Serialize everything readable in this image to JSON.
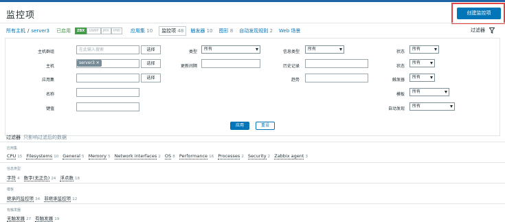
{
  "header": {
    "title": "监控项",
    "create_button": "创建监控项"
  },
  "breadcrumbs": {
    "all_hosts": "所有主机",
    "separator": "/",
    "host": "server3",
    "status": "已启用",
    "interfaces": [
      "ZBX",
      "SNMP",
      "JMX",
      "IPMI"
    ],
    "tabs": [
      {
        "label": "应用集",
        "count": "10"
      },
      {
        "label": "监控项",
        "count": "48"
      },
      {
        "label": "触发器",
        "count": "10"
      },
      {
        "label": "图形",
        "count": "8"
      },
      {
        "label": "自动发现规则",
        "count": "2"
      },
      {
        "label": "Web 场景",
        "count": ""
      }
    ]
  },
  "filter_toggle": {
    "label": "过滤器"
  },
  "filter": {
    "host_group": {
      "label": "主机群组",
      "placeholder": "在此输入搜索",
      "button": "选择"
    },
    "host": {
      "label": "主机",
      "tag": "server3",
      "button": "选择"
    },
    "application": {
      "label": "应用集",
      "button": "选择"
    },
    "name": {
      "label": "名称"
    },
    "key": {
      "label": "键值"
    },
    "type": {
      "label": "类型",
      "value": "所有"
    },
    "update_interval": {
      "label": "更新间隔"
    },
    "info_type": {
      "label": "信息类型",
      "value": "所有"
    },
    "history": {
      "label": "历史记录"
    },
    "trends": {
      "label": "趋势"
    },
    "state": {
      "label": "状态",
      "value": "所有"
    },
    "status": {
      "label": "状态",
      "value": "所有"
    },
    "triggers": {
      "label": "触发器",
      "value": "所有"
    },
    "template": {
      "label": "模板",
      "value": "所有"
    },
    "discovery": {
      "label": "自动发现",
      "value": "所有"
    },
    "apply": "应用",
    "reset": "重设"
  },
  "subfilter": {
    "title": "过滤器",
    "note": "只影响过滤后的数据",
    "groups": [
      {
        "heading": "应用集",
        "items": [
          {
            "label": "CPU",
            "count": "15"
          },
          {
            "label": "Filesystems",
            "count": "10"
          },
          {
            "label": "General",
            "count": "5"
          },
          {
            "label": "Memory",
            "count": "5"
          },
          {
            "label": "Network interfaces",
            "count": "2"
          },
          {
            "label": "OS",
            "count": "8"
          },
          {
            "label": "Performance",
            "count": "16"
          },
          {
            "label": "Processes",
            "count": "2"
          },
          {
            "label": "Security",
            "count": "2"
          },
          {
            "label": "Zabbix agent",
            "count": "3"
          }
        ]
      },
      {
        "heading": "信息类型",
        "items": [
          {
            "label": "字符",
            "count": "4"
          },
          {
            "label": "数字(无正负)",
            "count": "24"
          },
          {
            "label": "浮点数",
            "count": "18"
          }
        ]
      },
      {
        "heading": "模板",
        "items": [
          {
            "label": "继承的监控项",
            "count": "34"
          },
          {
            "label": "非继承监控项",
            "count": "12"
          }
        ]
      },
      {
        "heading": "有触发器",
        "items": [
          {
            "label": "无触发器",
            "count": "27"
          },
          {
            "label": "有触发器",
            "count": "19"
          }
        ]
      }
    ]
  }
}
